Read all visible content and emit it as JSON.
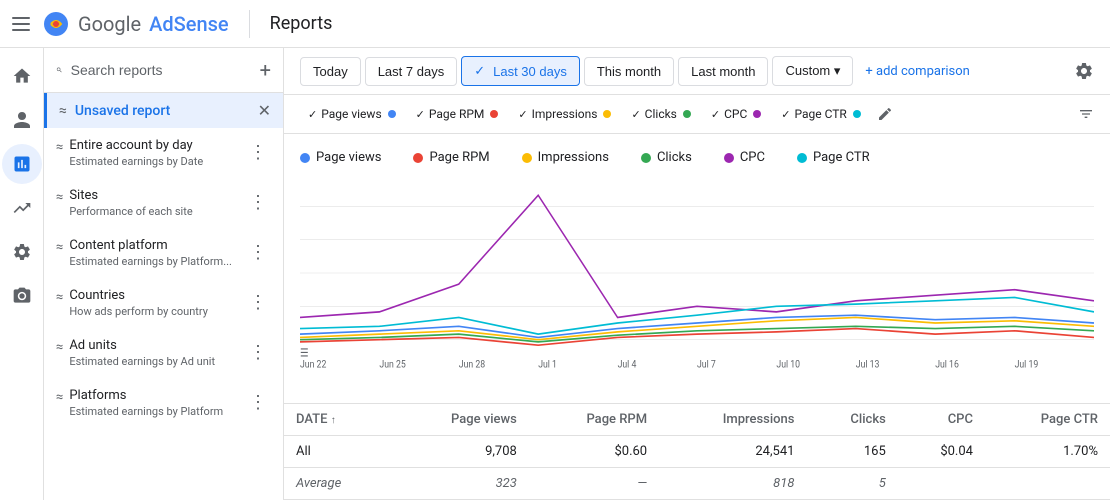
{
  "header": {
    "title": "Reports",
    "logo_text": "Google ",
    "logo_product": "AdSense"
  },
  "date_filters": {
    "buttons": [
      {
        "label": "Today",
        "active": false
      },
      {
        "label": "Last 7 days",
        "active": false
      },
      {
        "label": "Last 30 days",
        "active": true
      },
      {
        "label": "This month",
        "active": false
      },
      {
        "label": "Last month",
        "active": false
      },
      {
        "label": "Custom",
        "active": false,
        "has_arrow": true
      }
    ],
    "add_comparison": "+ add comparison"
  },
  "chart_filters": {
    "chips": [
      {
        "label": "Page views",
        "color": "#4285f4"
      },
      {
        "label": "Page RPM",
        "color": "#ea4335"
      },
      {
        "label": "Impressions",
        "color": "#fbbc04"
      },
      {
        "label": "Clicks",
        "color": "#34a853"
      },
      {
        "label": "CPC",
        "color": "#9c27b0"
      },
      {
        "label": "Page CTR",
        "color": "#00bcd4"
      }
    ]
  },
  "legend": {
    "items": [
      {
        "label": "Page views",
        "color": "#4285f4"
      },
      {
        "label": "Page RPM",
        "color": "#ea4335"
      },
      {
        "label": "Impressions",
        "color": "#fbbc04"
      },
      {
        "label": "Clicks",
        "color": "#34a853"
      },
      {
        "label": "CPC",
        "color": "#9c27b0"
      },
      {
        "label": "Page CTR",
        "color": "#00bcd4"
      }
    ]
  },
  "chart_x_labels": [
    "Jun 22",
    "Jun 25",
    "Jun 28",
    "Jul 1",
    "Jul 4",
    "Jul 7",
    "Jul 10",
    "Jul 13",
    "Jul 16",
    "Jul 19"
  ],
  "table": {
    "columns": [
      "DATE",
      "Page views",
      "Page RPM",
      "Impressions",
      "Clicks",
      "CPC",
      "Page CTR"
    ],
    "rows": [
      {
        "date": "All",
        "page_views": "9,708",
        "page_rpm": "$0.60",
        "impressions": "24,541",
        "clicks": "165",
        "cpc": "$0.04",
        "page_ctr": "1.70%"
      },
      {
        "date": "Average",
        "page_views": "323",
        "page_rpm": "—",
        "impressions": "818",
        "clicks": "5",
        "cpc": "",
        "page_ctr": ""
      }
    ]
  },
  "sidebar": {
    "search_placeholder": "Search reports",
    "add_icon": "+",
    "unsaved_report": "Unsaved report",
    "items": [
      {
        "title": "Entire account by day",
        "subtitle": "Estimated earnings by Date",
        "has_more": true
      },
      {
        "title": "Sites",
        "subtitle": "Performance of each site",
        "has_more": true
      },
      {
        "title": "Content platform",
        "subtitle": "Estimated earnings by Platform...",
        "has_more": true
      },
      {
        "title": "Countries",
        "subtitle": "How ads perform by country",
        "has_more": true
      },
      {
        "title": "Ad units",
        "subtitle": "Estimated earnings by Ad unit",
        "has_more": true
      },
      {
        "title": "Platforms",
        "subtitle": "Estimated earnings by Platform",
        "has_more": true
      }
    ]
  },
  "nav_icons": [
    "home",
    "person",
    "chart",
    "trending",
    "settings",
    "camera"
  ],
  "colors": {
    "active_nav": "#e8f0fe",
    "active_text": "#1a73e8",
    "active_filter_bg": "#e8f0fe",
    "active_filter_border": "#1a73e8"
  }
}
